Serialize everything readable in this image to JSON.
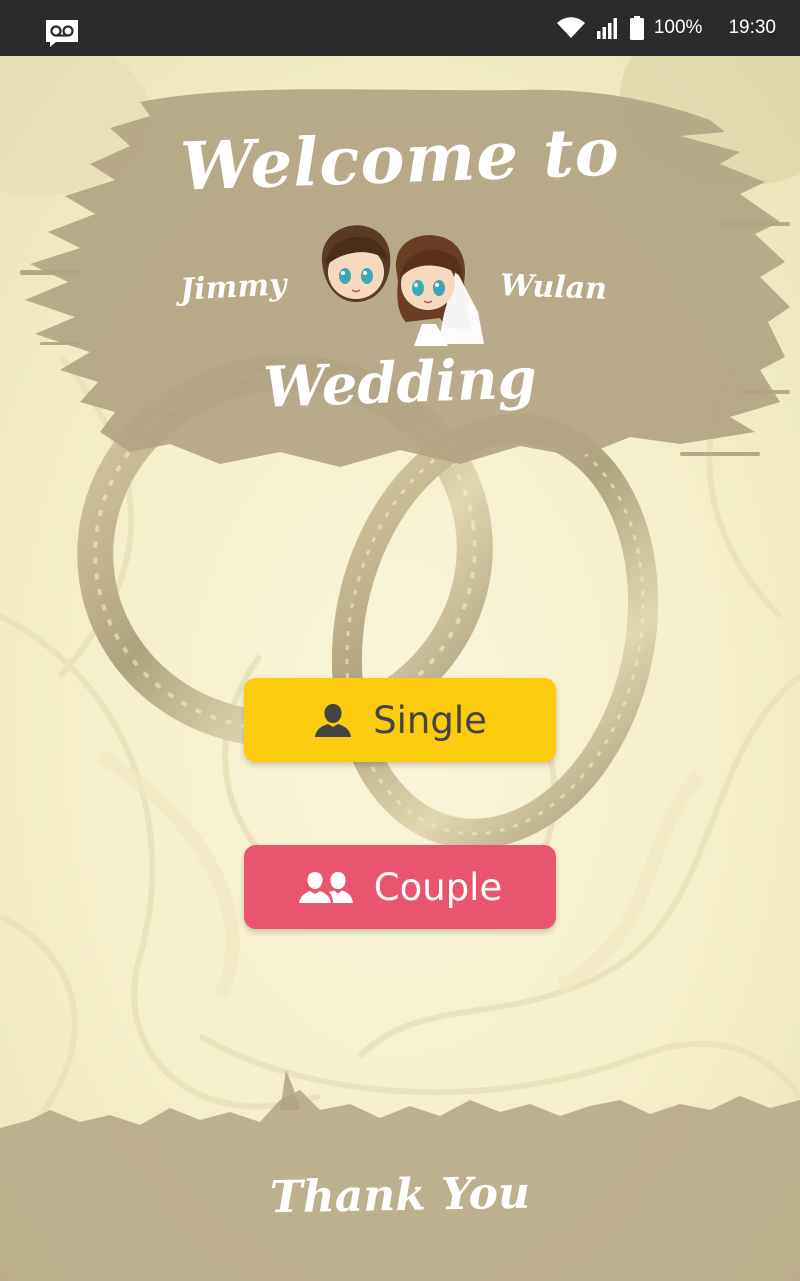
{
  "status_bar": {
    "battery": "100%",
    "time": "19:30",
    "icons": [
      "voicemail-icon",
      "wifi-icon",
      "signal-icon",
      "battery-icon"
    ]
  },
  "header": {
    "welcome": "Welcome to",
    "groom": "Jimmy",
    "bride": "Wulan",
    "wedding": "Wedding"
  },
  "buttons": {
    "single": {
      "label": "Single",
      "icon": "person-icon",
      "color": "#fbcb0d"
    },
    "couple": {
      "label": "Couple",
      "icon": "couple-icon",
      "color": "#e9546f"
    }
  },
  "footer": {
    "thank_you": "Thank You"
  },
  "colors": {
    "status_bar": "#2b2b2b",
    "brush": "#b3a584",
    "background": "#f3ecc8"
  }
}
